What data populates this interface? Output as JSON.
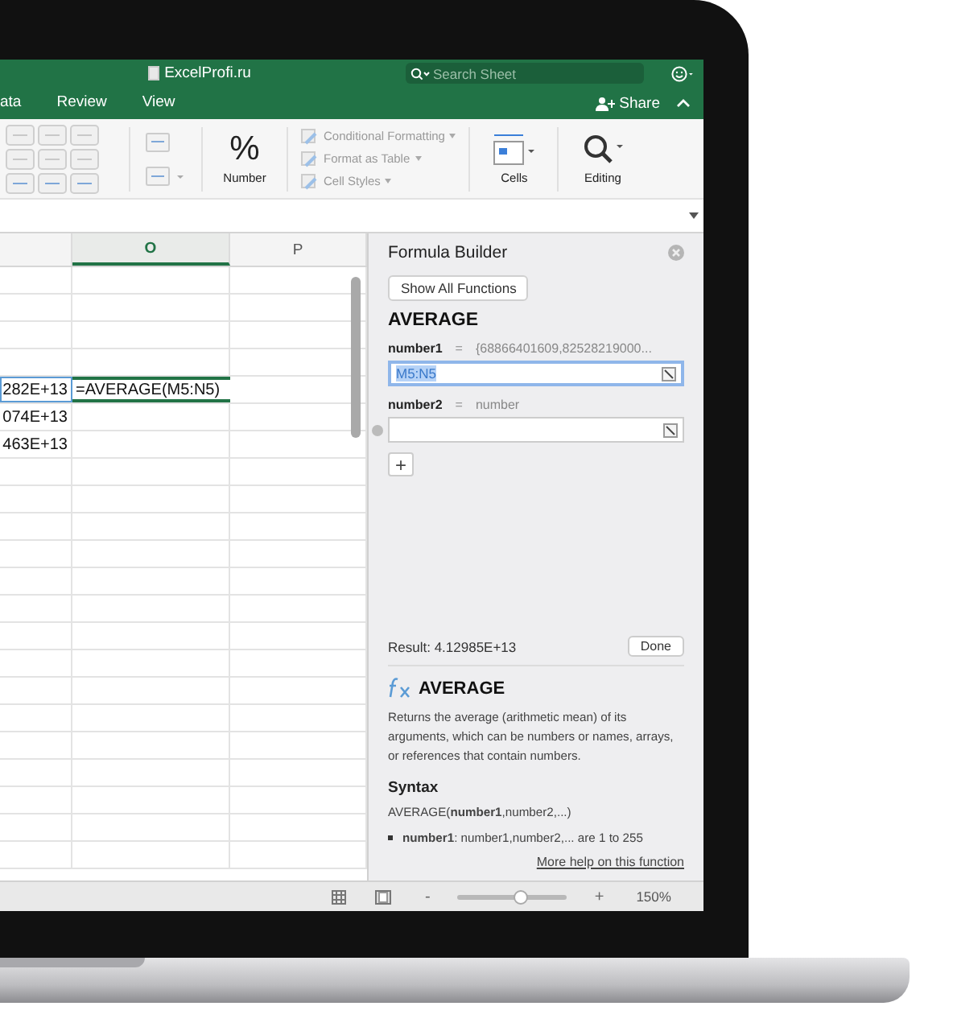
{
  "window": {
    "title": "ExcelProfi.ru",
    "search": {
      "placeholder": "Search Sheet"
    },
    "share": "Share"
  },
  "menu_tabs": [
    {
      "label": "ata",
      "selected": false
    },
    {
      "label": "Review",
      "selected": false
    },
    {
      "label": "View",
      "selected": false
    }
  ],
  "ribbon": {
    "number_group": {
      "symbol": "%",
      "label": "Number"
    },
    "styles": [
      {
        "label": "Conditional Formatting"
      },
      {
        "label": "Format as Table"
      },
      {
        "label": "Cell Styles"
      }
    ],
    "cells": {
      "label": "Cells"
    },
    "editing": {
      "label": "Editing"
    }
  },
  "sheet": {
    "columns": [
      {
        "label": "O",
        "selected": true
      },
      {
        "label": "P",
        "selected": false
      }
    ],
    "rows": [
      {},
      {},
      {},
      {},
      {
        "column_1": {
          "text": "282E+13",
          "referenced": true
        },
        "o": {
          "text": "=AVERAGE(M5:N5)",
          "active": true
        }
      },
      {
        "column_1": {
          "text": "074E+13",
          "referenced": false
        }
      },
      {
        "column_1": {
          "text": "463E+13",
          "referenced": false
        }
      }
    ]
  },
  "formula_builder": {
    "title": "Formula Builder",
    "back_button": "Show All Functions",
    "function": "AVERAGE",
    "arguments": [
      {
        "name": "number1",
        "separator": "=",
        "value": "{68866401609,82528219000...",
        "input": "M5:N5",
        "selected": true,
        "removable": false
      },
      {
        "name": "number2",
        "separator": "=",
        "value": "number",
        "selected": false,
        "removable": true
      }
    ],
    "add_button": "+",
    "result": "Result: 4.12985E+13",
    "done_button": "Done",
    "help": {
      "function": "AVERAGE",
      "description": "Returns the average (arithmetic mean) of its arguments, which can be numbers or names, arrays, or references that contain numbers.",
      "syntax_heading": "Syntax",
      "syntax": "AVERAGE(**number1**,number2,...)",
      "bullets": [
        "**number1**: number1,number2,... are 1 to 255"
      ],
      "link": "More help on this function"
    }
  },
  "status_bar": {
    "zoom_minus": "-",
    "zoom_plus": "+",
    "zoom": {
      "level": 0.57
    },
    "zoom_label": "150%"
  }
}
